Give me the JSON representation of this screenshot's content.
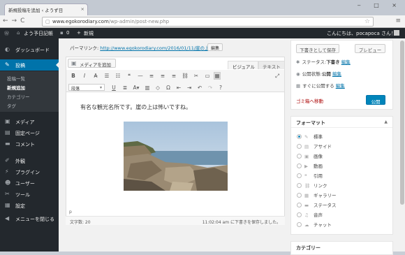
{
  "browser": {
    "tab_title": "新規投稿を追加 ‹ ようず日",
    "tab_close": "×",
    "url_prefix": "www.egokorodiary.com",
    "url_path": "/wp-admin/post-new.php",
    "window_controls": "‒ □ ×"
  },
  "admin_bar": {
    "site_name": "よう予日記帳",
    "comments_count": "0",
    "new_label": "新規",
    "greeting": "こんにちは、pocapoca さん！"
  },
  "sidebar": {
    "items": [
      {
        "label": "ダッシュボード"
      },
      {
        "label": "投稿"
      },
      {
        "label": "メディア"
      },
      {
        "label": "固定ページ"
      },
      {
        "label": "コメント"
      },
      {
        "label": "外観"
      },
      {
        "label": "プラグイン"
      },
      {
        "label": "ユーザー"
      },
      {
        "label": "ツール"
      },
      {
        "label": "設定"
      },
      {
        "label": "メニューを閉じる"
      }
    ],
    "subitems": [
      {
        "label": "投稿一覧"
      },
      {
        "label": "新規追加"
      },
      {
        "label": "カテゴリー"
      },
      {
        "label": "タグ"
      }
    ]
  },
  "permalink": {
    "label": "パーマリンク:",
    "url": "http://www.egokorodiary.com/2016/01/11/崖の上/",
    "edit_button": "編集"
  },
  "editor": {
    "media_button": "メディアを追加",
    "tab_visual": "ビジュアル",
    "tab_text": "テキスト",
    "format_select": "段落",
    "content_text": "有名な観光名所です。崖の上は怖いですね。",
    "path": "p",
    "word_count": "文字数: 20",
    "autosave": "11:02:04 am に下書きを保存しました。"
  },
  "publish": {
    "save_draft": "下書きとして保存",
    "preview": "プレビュー",
    "status_label": "ステータス:",
    "status_value": "下書き",
    "visibility_label": "公開状態:",
    "visibility_value": "公開",
    "schedule_label": "すぐに公開する",
    "edit_link": "編集",
    "trash": "ゴミ箱へ移動",
    "publish_button": "公開"
  },
  "format_box": {
    "title": "フォーマット",
    "options": [
      {
        "label": "標準",
        "selected": true
      },
      {
        "label": "アサイド",
        "selected": false
      },
      {
        "label": "画像",
        "selected": false
      },
      {
        "label": "動画",
        "selected": false
      },
      {
        "label": "引用",
        "selected": false
      },
      {
        "label": "リンク",
        "selected": false
      },
      {
        "label": "ギャラリー",
        "selected": false
      },
      {
        "label": "ステータス",
        "selected": false
      },
      {
        "label": "音声",
        "selected": false
      },
      {
        "label": "チャット",
        "selected": false
      }
    ]
  },
  "category_box": {
    "title": "カテゴリー"
  },
  "colors": {
    "admin_dark": "#23282d",
    "accent": "#0073aa",
    "publish": "#0085ba"
  }
}
